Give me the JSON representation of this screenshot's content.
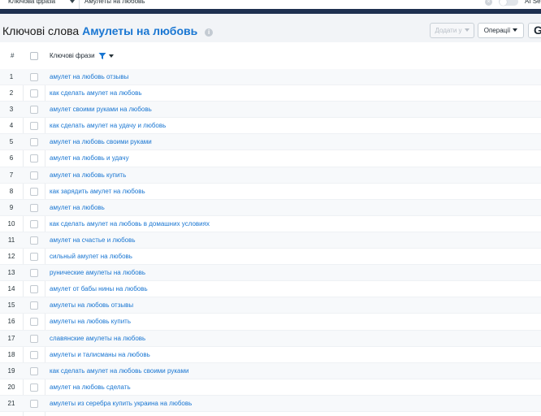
{
  "search_bar": {
    "mode_select": "Ключова фраза",
    "query": "Амулеты на любовь",
    "ai_label": "AI Se"
  },
  "header": {
    "title_prefix": "Ключові слова",
    "title_phrase": "Амулеты на любовь",
    "add_button": "Додати у",
    "operations_button": "Операції",
    "g_button": "G"
  },
  "table": {
    "col_number": "#",
    "col_phrase": "Ключові фрази",
    "rows": [
      {
        "n": "1",
        "phrase": "амулет на любовь отзывы"
      },
      {
        "n": "2",
        "phrase": "как сделать амулет на любовь"
      },
      {
        "n": "3",
        "phrase": "амулет своими руками на любовь"
      },
      {
        "n": "4",
        "phrase": "как сделать амулет на удачу и любовь"
      },
      {
        "n": "5",
        "phrase": "амулет на любовь своими руками"
      },
      {
        "n": "6",
        "phrase": "амулет на любовь и удачу"
      },
      {
        "n": "7",
        "phrase": "амулет на любовь купить"
      },
      {
        "n": "8",
        "phrase": "как зарядить амулет на любовь"
      },
      {
        "n": "9",
        "phrase": "амулет на любовь"
      },
      {
        "n": "10",
        "phrase": "как сделать амулет на любовь в домашних условиях"
      },
      {
        "n": "11",
        "phrase": "амулет на счастье и любовь"
      },
      {
        "n": "12",
        "phrase": "сильный амулет на любовь"
      },
      {
        "n": "13",
        "phrase": "рунические амулеты на любовь"
      },
      {
        "n": "14",
        "phrase": "амулет от бабы нины на любовь"
      },
      {
        "n": "15",
        "phrase": "амулеты на любовь отзывы"
      },
      {
        "n": "16",
        "phrase": "амулеты на любовь купить"
      },
      {
        "n": "17",
        "phrase": "славянские амулеты на любовь"
      },
      {
        "n": "18",
        "phrase": "амулеты и талисманы на любовь"
      },
      {
        "n": "19",
        "phrase": "как сделать амулет на любовь своими руками"
      },
      {
        "n": "20",
        "phrase": "амулет на любовь сделать"
      },
      {
        "n": "21",
        "phrase": "амулеты из серебра купить украина на любовь"
      }
    ]
  },
  "colors": {
    "link": "#1976d2",
    "nav_band": "#1e3050",
    "filter_icon": "#1976d2"
  }
}
